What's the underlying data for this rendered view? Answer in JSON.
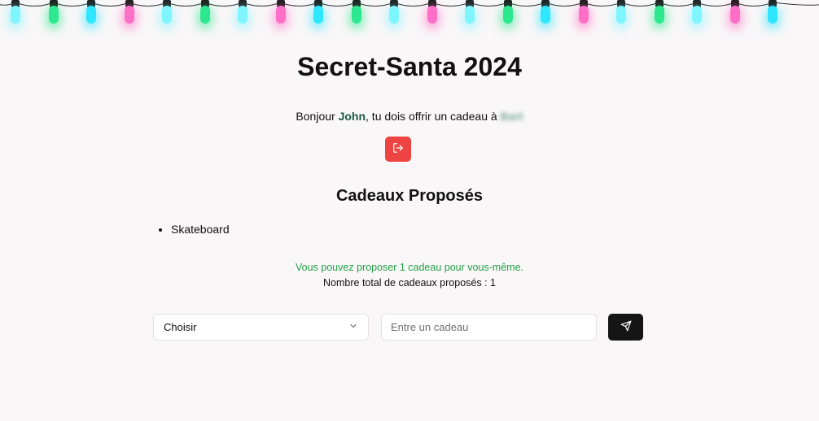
{
  "title": "Secret-Santa 2024",
  "greeting": {
    "prefix": "Bonjour ",
    "user": "John",
    "middle": ", tu dois offrir un cadeau à ",
    "recipient": "Bart"
  },
  "logout_icon": "logout-icon",
  "gifts_section": {
    "title": "Cadeaux Proposés",
    "items": [
      "Skateboard"
    ]
  },
  "info_message": "Vous pouvez proposer 1 cadeau pour vous-même.",
  "total_message": "Nombre total de cadeaux proposés : 1",
  "form": {
    "select_value": "Choisir",
    "input_placeholder": "Entre un cadeau",
    "send_icon": "send-icon"
  },
  "colors": {
    "background": "#f9f7f8",
    "user_name": "#1c5a45",
    "info_green": "#22a046",
    "logout_button": "#ee4444",
    "send_button": "#151515",
    "light_colors": [
      "#7ef5ff",
      "#2ee88f",
      "#2fe6ff",
      "#ff6ec7"
    ]
  }
}
